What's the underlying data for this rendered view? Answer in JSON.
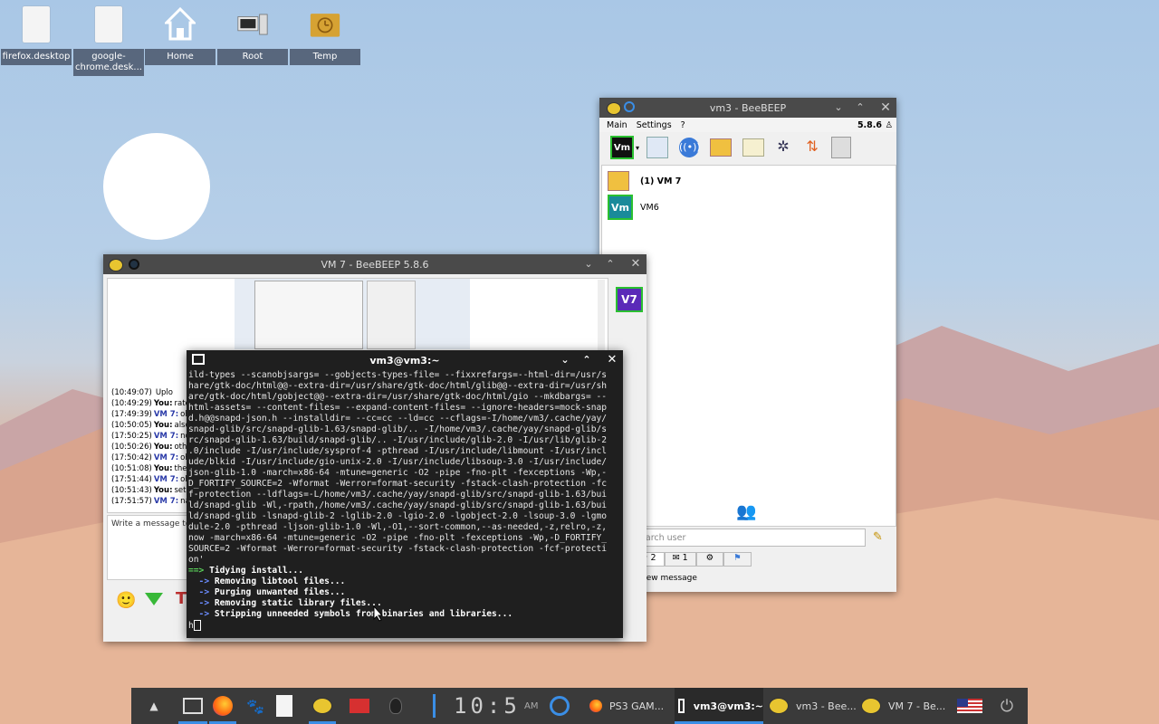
{
  "desktop_icons": [
    {
      "label": "firefox.desktop",
      "icon": "document-icon"
    },
    {
      "label": "google-chrome.desk...",
      "icon": "document-icon"
    },
    {
      "label": "Home",
      "icon": "home-icon"
    },
    {
      "label": "Root",
      "icon": "computer-icon"
    },
    {
      "label": "Temp",
      "icon": "folder-clock-icon"
    }
  ],
  "beebeep_main": {
    "title": "vm3 - BeeBEEP",
    "menu": [
      "Main",
      "Settings",
      "?"
    ],
    "version": "5.8.6",
    "users": [
      {
        "name": "(1) VM 7",
        "avatar": "envelope-icon"
      },
      {
        "name": "VM6",
        "avatar": "Vm"
      }
    ],
    "search_placeholder": "Search user",
    "tabs": [
      "2",
      "1",
      "",
      ""
    ],
    "status_text": "new message"
  },
  "vm7_chat": {
    "title": "VM 7 - BeeBEEP 5.8.6",
    "avatar": "V7",
    "messages": [
      {
        "time": "(10:49:07)",
        "who": "",
        "text": "Uplo"
      },
      {
        "time": "(10:49:29)",
        "who": "You:",
        "text": "rate"
      },
      {
        "time": "(17:49:39)",
        "who": "VM 7:",
        "text": "oh"
      },
      {
        "time": "(10:50:05)",
        "who": "You:",
        "text": "also"
      },
      {
        "time": "(17:50:25)",
        "who": "VM 7:",
        "text": "no"
      },
      {
        "time": "(10:50:26)",
        "who": "You:",
        "text": "othe"
      },
      {
        "time": "(17:50:42)",
        "who": "VM 7:",
        "text": "oh"
      },
      {
        "time": "(10:51:08)",
        "who": "You:",
        "text": "there"
      },
      {
        "time": "(17:51:44)",
        "who": "VM 7:",
        "text": "oh"
      },
      {
        "time": "(10:51:43)",
        "who": "You:",
        "text": "set t"
      },
      {
        "time": "(17:51:57)",
        "who": "VM 7:",
        "text": "nac"
      }
    ],
    "input_placeholder": "Write a message to V"
  },
  "terminal": {
    "title": "vm3@vm3:~",
    "lines": [
      "ild-types --scanobjsargs= --gobjects-types-file= --fixxrefargs=--html-dir=/usr/s",
      "hare/gtk-doc/html@@--extra-dir=/usr/share/gtk-doc/html/glib@@--extra-dir=/usr/sh",
      "are/gtk-doc/html/gobject@@--extra-dir=/usr/share/gtk-doc/html/gio --mkdbargs= --",
      "html-assets= --content-files= --expand-content-files= --ignore-headers=mock-snap",
      "d.h@@snapd-json.h --installdir= --cc=cc --ld=cc --cflags=-I/home/vm3/.cache/yay/",
      "snapd-glib/src/snapd-glib-1.63/snapd-glib/.. -I/home/vm3/.cache/yay/snapd-glib/s",
      "rc/snapd-glib-1.63/build/snapd-glib/.. -I/usr/include/glib-2.0 -I/usr/lib/glib-2",
      ".0/include -I/usr/include/sysprof-4 -pthread -I/usr/include/libmount -I/usr/incl",
      "ude/blkid -I/usr/include/gio-unix-2.0 -I/usr/include/libsoup-3.0 -I/usr/include/",
      "json-glib-1.0 -march=x86-64 -mtune=generic -O2 -pipe -fno-plt -fexceptions -Wp,-",
      "D_FORTIFY_SOURCE=2 -Wformat -Werror=format-security -fstack-clash-protection -fc",
      "f-protection --ldflags=-L/home/vm3/.cache/yay/snapd-glib/src/snapd-glib-1.63/bui",
      "ld/snapd-glib -Wl,-rpath,/home/vm3/.cache/yay/snapd-glib/src/snapd-glib-1.63/bui",
      "ld/snapd-glib -lsnapd-glib-2 -lglib-2.0 -lgio-2.0 -lgobject-2.0 -lsoup-3.0 -lgmo",
      "dule-2.0 -pthread -ljson-glib-1.0 -Wl,-O1,--sort-common,--as-needed,-z,relro,-z,",
      "now -march=x86-64 -mtune=generic -O2 -pipe -fno-plt -fexceptions -Wp,-D_FORTIFY_",
      "SOURCE=2 -Wformat -Werror=format-security -fstack-clash-protection -fcf-protecti",
      "on'"
    ],
    "step_main": "Tidying install...",
    "steps": [
      "Removing libtool files...",
      "Purging unwanted files...",
      "Removing static library files...",
      "Stripping unneeded symbols from binaries and libraries..."
    ],
    "prompt": "h"
  },
  "taskbar": {
    "clock": "10:5",
    "ampm": "AM",
    "tasks": [
      {
        "label": "PS3 GAM...",
        "icon": "firefox-icon"
      },
      {
        "label": "vm3@vm3:~",
        "icon": "terminal-icon"
      },
      {
        "label": "vm3 - Bee...",
        "icon": "beebeep-icon"
      },
      {
        "label": "VM 7 - Be...",
        "icon": "beebeep-icon"
      }
    ]
  },
  "colors": {
    "accent": "#3a8ee6",
    "titlebar": "#4a4a4a",
    "terminal_bg": "#1f1f1f"
  }
}
